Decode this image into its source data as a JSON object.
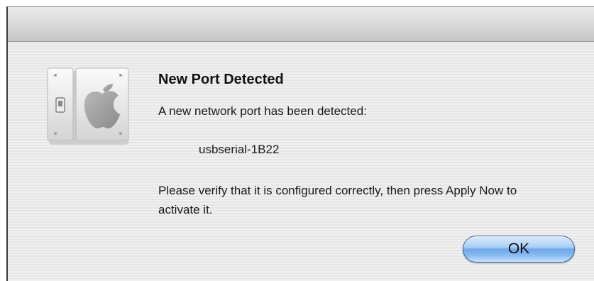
{
  "dialog": {
    "icon": "system-preferences-network-icon",
    "title": "New Port Detected",
    "message": "A new network port has been detected:",
    "port_name": "usbserial-1B22",
    "instructions": "Please verify that it is configured correctly, then press Apply Now to activate it.",
    "ok_label": "OK"
  },
  "colors": {
    "button_accent": "#6ea7e6",
    "dialog_background": "#ececec"
  }
}
